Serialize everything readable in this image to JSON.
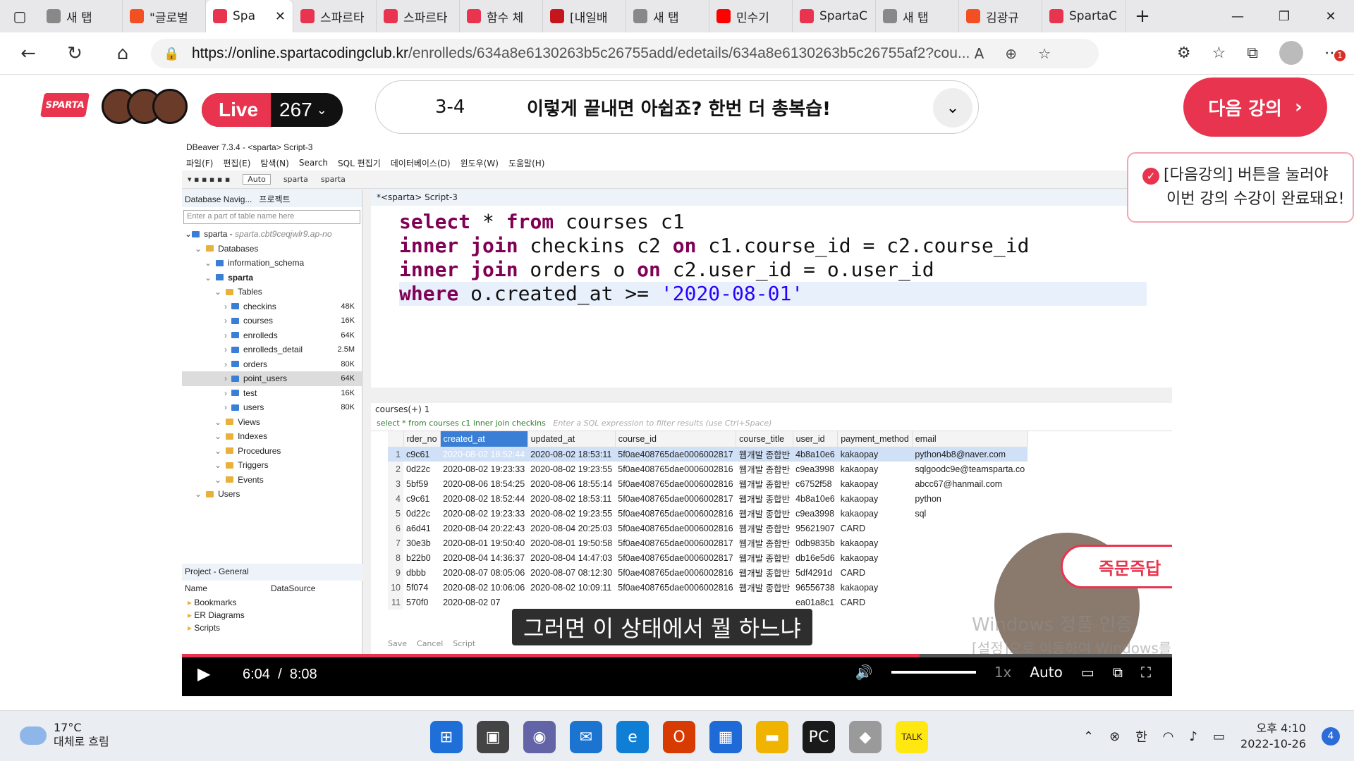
{
  "browser": {
    "tabs": [
      {
        "label": "새 탭",
        "color": "#888888"
      },
      {
        "label": "\"글로벌",
        "color": "#f25022"
      },
      {
        "label": "Spa",
        "color": "#e8344e",
        "active": true
      },
      {
        "label": "스파르타",
        "color": "#e8344e"
      },
      {
        "label": "스파르타",
        "color": "#e8344e"
      },
      {
        "label": "함수 체",
        "color": "#e8344e"
      },
      {
        "label": "[내일배",
        "color": "#c4161c"
      },
      {
        "label": "새 탭",
        "color": "#888888"
      },
      {
        "label": "민수기",
        "color": "#ff0000"
      },
      {
        "label": "SpartaC",
        "color": "#e8344e"
      },
      {
        "label": "새 탭",
        "color": "#888888"
      },
      {
        "label": "김광규",
        "color": "#f25022"
      },
      {
        "label": "SpartaC",
        "color": "#e8344e"
      }
    ],
    "url_domain": "https://online.spartacodingclub.kr",
    "url_path": "/enrolleds/634a8e6130263b5c26755add/edetails/634a8e6130263b5c26755af2?cou...",
    "profile_badge": "1"
  },
  "header": {
    "logo": "SPARTA",
    "live_label": "Live",
    "live_count": "267",
    "lecture_number": "3-4",
    "lecture_title": "이렇게 끝내면 아쉽죠? 한번 더 총복습!",
    "next_button": "다음 강의",
    "tip_line1": "[다음강의] 버튼을 눌러야",
    "tip_line2": "이번 강의 수강이 완료돼요!"
  },
  "dbeaver": {
    "title": "DBeaver 7.3.4 - <sparta> Script-3",
    "menu": [
      "파일(F)",
      "편집(E)",
      "탐색(N)",
      "Search",
      "SQL 편집기",
      "데이터베이스(D)",
      "윈도우(W)",
      "도움말(H)"
    ],
    "toolbar_mode": "Auto",
    "toolbar_db": "sparta",
    "toolbar_schema": "sparta",
    "nav_title": "Database Navig...",
    "nav_tab2": "프로젝트",
    "filter_placeholder": "Enter a part of table name here",
    "connection": "sparta",
    "connection_host": "sparta.cbt9ceqjwlr9.ap-no",
    "tree": [
      {
        "label": "Databases",
        "indent": 1,
        "folder": true
      },
      {
        "label": "information_schema",
        "indent": 2
      },
      {
        "label": "sparta",
        "indent": 2,
        "bold": true
      },
      {
        "label": "Tables",
        "indent": 3,
        "folder": true
      },
      {
        "label": "checkins",
        "indent": 4,
        "size": "48K"
      },
      {
        "label": "courses",
        "indent": 4,
        "size": "16K"
      },
      {
        "label": "enrolleds",
        "indent": 4,
        "size": "64K"
      },
      {
        "label": "enrolleds_detail",
        "indent": 4,
        "size": "2.5M"
      },
      {
        "label": "orders",
        "indent": 4,
        "size": "80K"
      },
      {
        "label": "point_users",
        "indent": 4,
        "size": "64K",
        "selected": true
      },
      {
        "label": "test",
        "indent": 4,
        "size": "16K"
      },
      {
        "label": "users",
        "indent": 4,
        "size": "80K"
      },
      {
        "label": "Views",
        "indent": 3,
        "folder": true
      },
      {
        "label": "Indexes",
        "indent": 3,
        "folder": true
      },
      {
        "label": "Procedures",
        "indent": 3,
        "folder": true
      },
      {
        "label": "Triggers",
        "indent": 3,
        "folder": true
      },
      {
        "label": "Events",
        "indent": 3,
        "folder": true
      },
      {
        "label": "Users",
        "indent": 1,
        "folder": true
      }
    ],
    "project_title": "Project - General",
    "project_cols": [
      "Name",
      "DataSource"
    ],
    "project_items": [
      "Bookmarks",
      "ER Diagrams",
      "Scripts"
    ],
    "editor_tab": "*<sparta> Script-3",
    "sql": {
      "line1_kw1": "select",
      "line1_rest": " * ",
      "line1_kw2": "from",
      "line1_tail": " courses c1",
      "line2_kw1": "inner join",
      "line2_mid": " checkins c2 ",
      "line2_kw2": "on",
      "line2_tail": " c1.course_id = c2.course_id",
      "line3_kw1": "inner join",
      "line3_mid": " orders o ",
      "line3_kw2": "on",
      "line3_tail": " c2.user_id = o.user_id",
      "line4_kw": "where",
      "line4_mid": " o.created_at >= ",
      "line4_str": "'2020-08-01'"
    },
    "results_tab": "courses(+) 1",
    "results_filter": "select * from courses c1 inner join checkins",
    "results_filter_hint": "Enter a SQL expression to filter results (use Ctrl+Space)",
    "columns": [
      "rder_no",
      "created_at",
      "updated_at",
      "course_id",
      "course_title",
      "user_id",
      "payment_method",
      "email"
    ],
    "rows": [
      [
        "1",
        "c9c61",
        "2020-08-02 18:52:44",
        "2020-08-02 18:53:11",
        "5f0ae408765dae0006002817",
        "웹개발 종합반",
        "4b8a10e6",
        "kakaopay",
        "python4b8@naver.com"
      ],
      [
        "2",
        "0d22c",
        "2020-08-02 19:23:33",
        "2020-08-02 19:23:55",
        "5f0ae408765dae0006002816",
        "웹개발 종합반",
        "c9ea3998",
        "kakaopay",
        "sqlgoodc9e@teamsparta.co"
      ],
      [
        "3",
        "5bf59",
        "2020-08-06 18:54:25",
        "2020-08-06 18:55:14",
        "5f0ae408765dae0006002816",
        "웹개발 종합반",
        "c6752f58",
        "kakaopay",
        "abcc67@hanmail.com"
      ],
      [
        "4",
        "c9c61",
        "2020-08-02 18:52:44",
        "2020-08-02 18:53:11",
        "5f0ae408765dae0006002817",
        "웹개발 종합반",
        "4b8a10e6",
        "kakaopay",
        "python"
      ],
      [
        "5",
        "0d22c",
        "2020-08-02 19:23:33",
        "2020-08-02 19:23:55",
        "5f0ae408765dae0006002816",
        "웹개발 종합반",
        "c9ea3998",
        "kakaopay",
        "sql"
      ],
      [
        "6",
        "a6d41",
        "2020-08-04 20:22:43",
        "2020-08-04 20:25:03",
        "5f0ae408765dae0006002816",
        "웹개발 종합반",
        "95621907",
        "CARD",
        ""
      ],
      [
        "7",
        "30e3b",
        "2020-08-01 19:50:40",
        "2020-08-01 19:50:58",
        "5f0ae408765dae0006002817",
        "웹개발 종합반",
        "0db9835b",
        "kakaopay",
        ""
      ],
      [
        "8",
        "b22b0",
        "2020-08-04 14:36:37",
        "2020-08-04 14:47:03",
        "5f0ae408765dae0006002817",
        "웹개발 종합반",
        "db16e5d6",
        "kakaopay",
        ""
      ],
      [
        "9",
        "dbbb",
        "2020-08-07 08:05:06",
        "2020-08-07 08:12:30",
        "5f0ae408765dae0006002816",
        "웹개발 종합반",
        "5df4291d",
        "CARD",
        ""
      ],
      [
        "10",
        "5f074",
        "2020-08-02 10:06:06",
        "2020-08-02 10:09:11",
        "5f0ae408765dae0006002816",
        "웹개발 종합반",
        "96556738",
        "kakaopay",
        ""
      ],
      [
        "11",
        "570f0",
        "2020-08-02 07",
        "",
        "",
        "",
        "ea01a8c1",
        "CARD",
        ""
      ]
    ],
    "footer": [
      "Save",
      "Cancel",
      "Script"
    ]
  },
  "video": {
    "subtitle": "그러면 이 상태에서 뭘 하느냐",
    "badge": "즉문즉답",
    "watermark1": "Windows 정품 인증",
    "watermark2": "[설정]으로 이동하여 Windows를 정품 인증합니다.",
    "current_time": "6:04",
    "separator": "/",
    "duration": "8:08",
    "progress": 0.745,
    "speed": "1x",
    "quality": "Auto"
  },
  "taskbar": {
    "temp": "17°C",
    "weather": "대체로 흐림",
    "ime": "한",
    "time": "오후 4:10",
    "date": "2022-10-26",
    "notifications": "4"
  }
}
